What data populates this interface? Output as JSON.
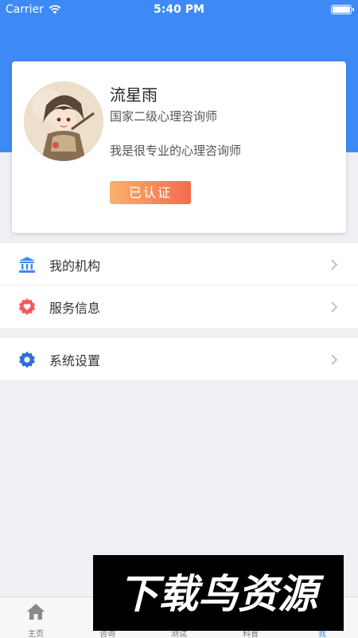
{
  "status_bar": {
    "carrier": "Carrier",
    "time": "5:40 PM"
  },
  "profile": {
    "name": "流星雨",
    "title": "国家二级心理咨询师",
    "description": "我是很专业的心理咨询师",
    "badge": "已认证",
    "avatar_icon": "anime-character-avatar"
  },
  "menu_group_1": [
    {
      "label": "我的机构",
      "icon": "institution-icon"
    },
    {
      "label": "服务信息",
      "icon": "heart-badge-icon"
    }
  ],
  "menu_group_2": [
    {
      "label": "系统设置",
      "icon": "gear-icon"
    }
  ],
  "tab_bar": {
    "tabs": [
      {
        "label": "主页",
        "icon": "home-icon"
      },
      {
        "label": "咨询",
        "icon": "chat-icon"
      },
      {
        "label": "测试",
        "icon": "test-icon"
      },
      {
        "label": "科普",
        "icon": "book-icon"
      },
      {
        "label": "我",
        "icon": "user-icon"
      }
    ],
    "active_index": 4
  },
  "watermark": {
    "text": "下载鸟资源"
  },
  "colors": {
    "brand_blue": "#3d8af7",
    "badge_start": "#fbb06a",
    "badge_end": "#f46c4f",
    "heart_red": "#f25b5b"
  }
}
